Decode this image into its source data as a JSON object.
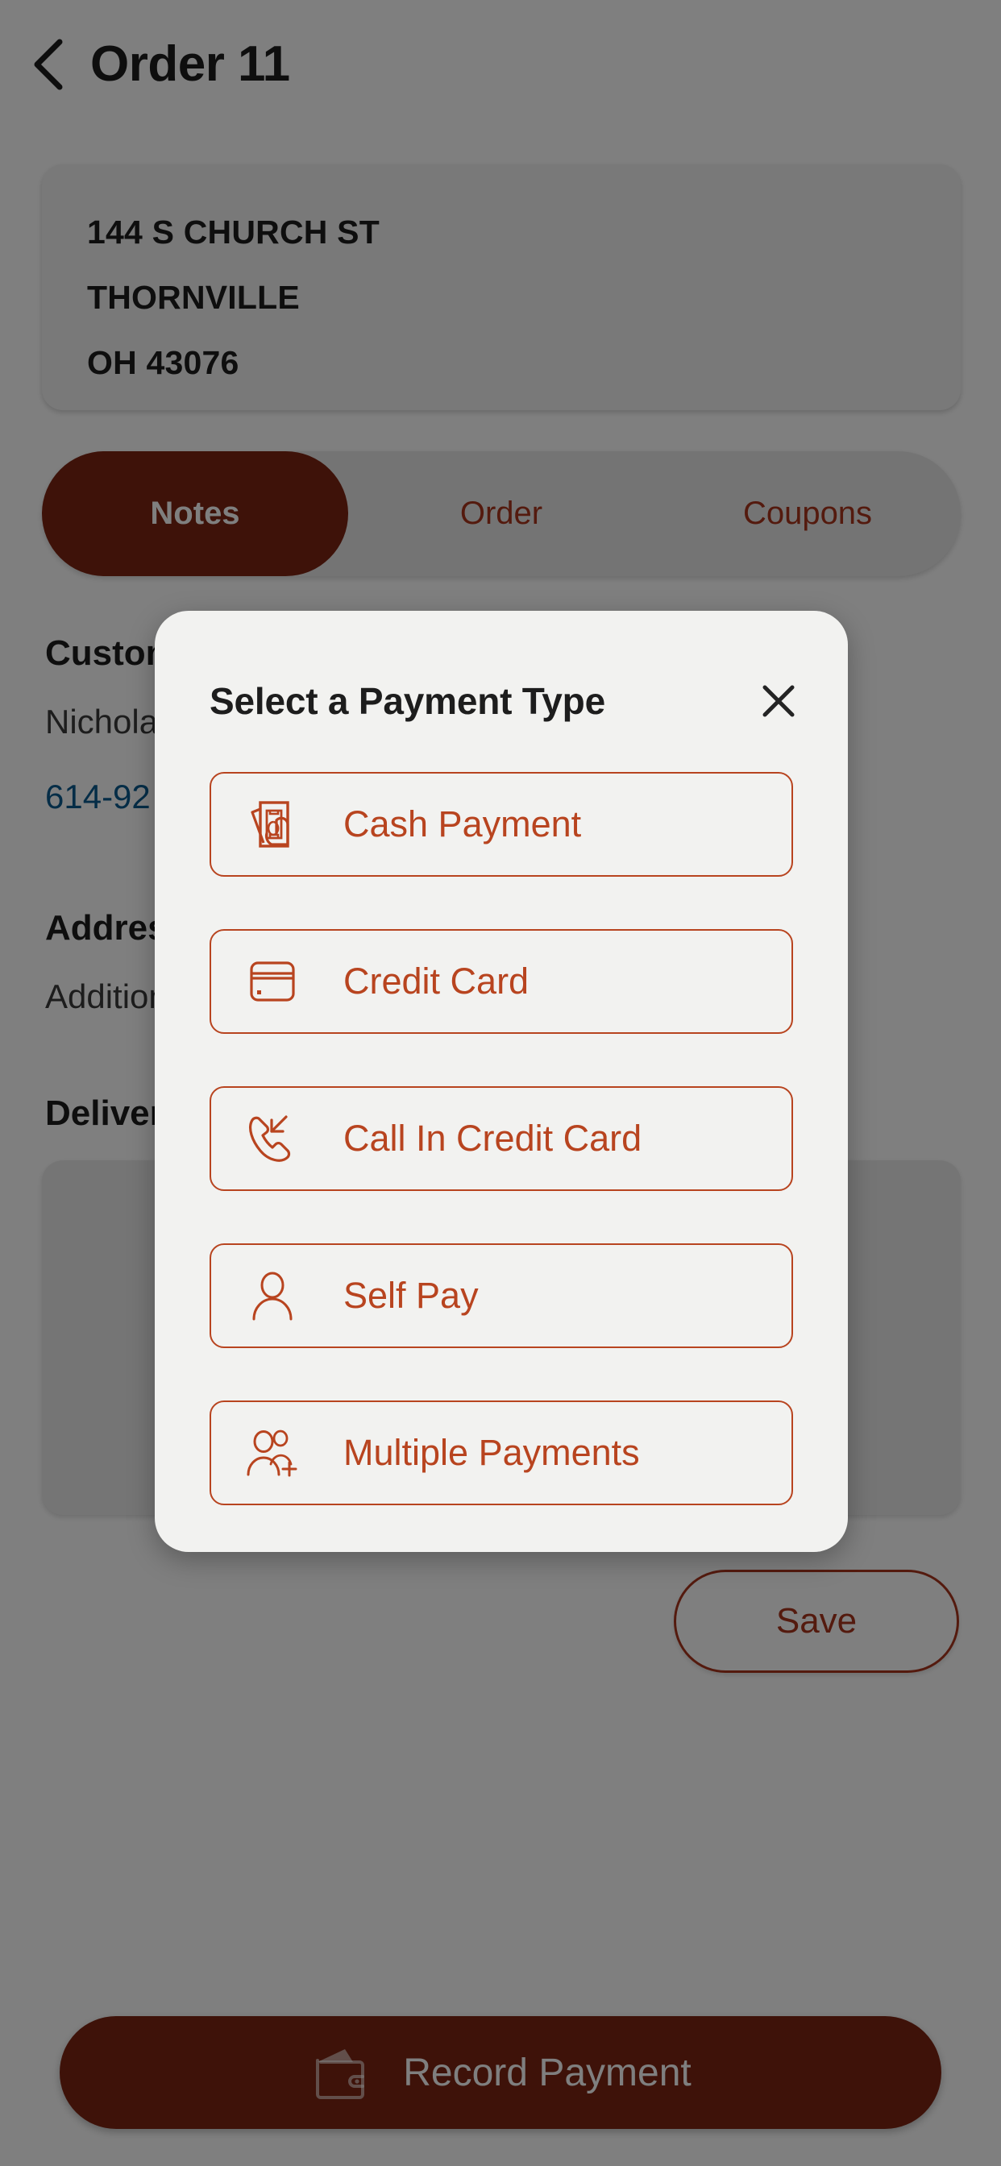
{
  "header": {
    "back_icon": "chevron-left-icon",
    "title": "Order 11"
  },
  "address_card": {
    "line1": "144 S CHURCH ST",
    "line2": "THORNVILLE",
    "line3": "OH 43076"
  },
  "tabs": [
    {
      "label": "Notes",
      "active": true
    },
    {
      "label": "Order",
      "active": false
    },
    {
      "label": "Coupons",
      "active": false
    }
  ],
  "details": {
    "customer_label": "Customer",
    "customer_name": "Nicholas",
    "customer_phone": "614-92",
    "address_label": "Address",
    "address_value": "Additional",
    "delivery_label": "Delivery"
  },
  "save_button": {
    "label": "Save"
  },
  "record_payment": {
    "label": "Record Payment",
    "icon": "wallet-icon"
  },
  "modal": {
    "title": "Select a Payment Type",
    "close_icon": "close-icon",
    "options": [
      {
        "label": "Cash Payment",
        "icon": "cash-in-hand-icon"
      },
      {
        "label": "Credit Card",
        "icon": "credit-card-icon"
      },
      {
        "label": "Call In Credit Card",
        "icon": "phone-incoming-icon"
      },
      {
        "label": "Self Pay",
        "icon": "person-icon"
      },
      {
        "label": "Multiple Payments",
        "icon": "people-add-icon"
      }
    ]
  },
  "colors": {
    "brand_dark": "#7d2412",
    "brand": "#b8441f",
    "accent_link": "#0b5a8e",
    "modal_bg": "#f2f2f0",
    "scrim": "rgba(0,0,0,0.50)"
  }
}
